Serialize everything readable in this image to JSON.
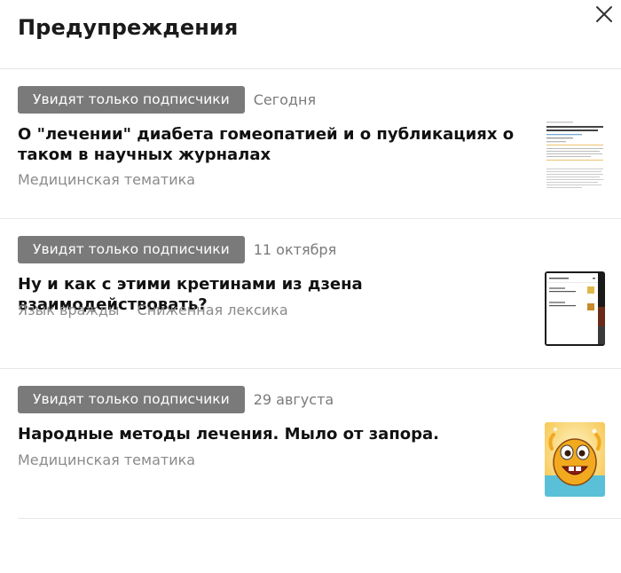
{
  "header": {
    "title": "Предупреждения",
    "close_icon": "close-icon"
  },
  "warnings": [
    {
      "badge": "Увидят только подписчики",
      "date": "Сегодня",
      "title": "О \"лечении\" диабета гомеопатией и о публикациях о таком в научных журналах",
      "tags": [
        "Медицинская тематика"
      ],
      "thumbnail": "article-page-thumbnail"
    },
    {
      "badge": "Увидят только подписчики",
      "date": "11 октября",
      "title": "Ну и как с этими кретинами из дзена взаимодействовать?",
      "tags": [
        "Язык вражды",
        "Сниженная лексика"
      ],
      "thumbnail": "screenshot-thumbnail"
    },
    {
      "badge": "Увидят только подписчики",
      "date": "29 августа",
      "title": "Народные методы лечения. Мыло от запора.",
      "tags": [
        "Медицинская тематика"
      ],
      "thumbnail": "cartoon-character-thumbnail"
    }
  ],
  "colors": {
    "badge_bg": "#7a7a7a",
    "secondary_text": "#8a8a8a",
    "divider": "#e6e6e6"
  }
}
